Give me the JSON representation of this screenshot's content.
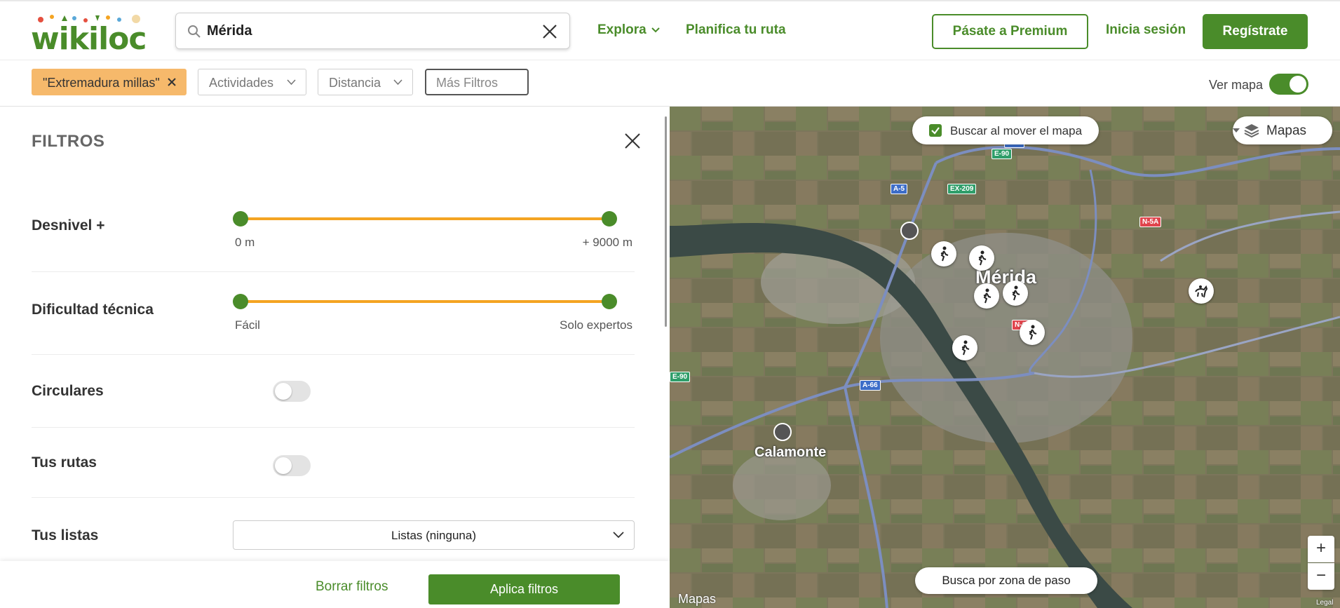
{
  "header": {
    "logo_text": "wikiloc",
    "search": {
      "value": "Mérida",
      "placeholder": ""
    },
    "nav": {
      "explora": "Explora",
      "planifica": "Planifica tu ruta",
      "login": "Inicia sesión"
    },
    "premium_label": "Pásate a Premium",
    "register_label": "Regístrate",
    "accent_color": "#4a8c2a"
  },
  "chipbar": {
    "active_chip": "\"Extremadura millas\"",
    "actividades": "Actividades",
    "distancia": "Distancia",
    "mas_filtros": "Más Filtros",
    "ver_mapa": "Ver mapa"
  },
  "panel": {
    "title": "FILTROS",
    "desnivel": {
      "label": "Desnivel +",
      "min": "0 m",
      "max": "+ 9000 m",
      "range": [
        0,
        1
      ]
    },
    "dificultad": {
      "label": "Dificultad técnica",
      "min": "Fácil",
      "max": "Solo expertos",
      "range": [
        0,
        1
      ]
    },
    "circulares": {
      "label": "Circulares",
      "on": false
    },
    "tus_rutas": {
      "label": "Tus rutas",
      "on": false
    },
    "tus_listas": {
      "label": "Tus listas",
      "value": "Listas (ninguna)"
    },
    "clear_label": "Borrar filtros",
    "apply_label": "Aplica filtros",
    "slider_color": "#f4a422"
  },
  "map": {
    "search_on_move": "Buscar al mover el mapa",
    "layers_label": "Mapas",
    "zona_paso": "Busca por zona de paso",
    "zoom_in": "+",
    "zoom_out": "−",
    "cities": {
      "merida": "Mérida",
      "calamonte": "Calamonte"
    },
    "roads": {
      "e90_top": "E-90",
      "a5": "A-5",
      "ex209": "EX-209",
      "n5a": "N-5A",
      "n630": "N-630",
      "e90_left": "E-90",
      "a66": "A-66"
    },
    "brand": "Mapas",
    "legal": "Legal"
  }
}
